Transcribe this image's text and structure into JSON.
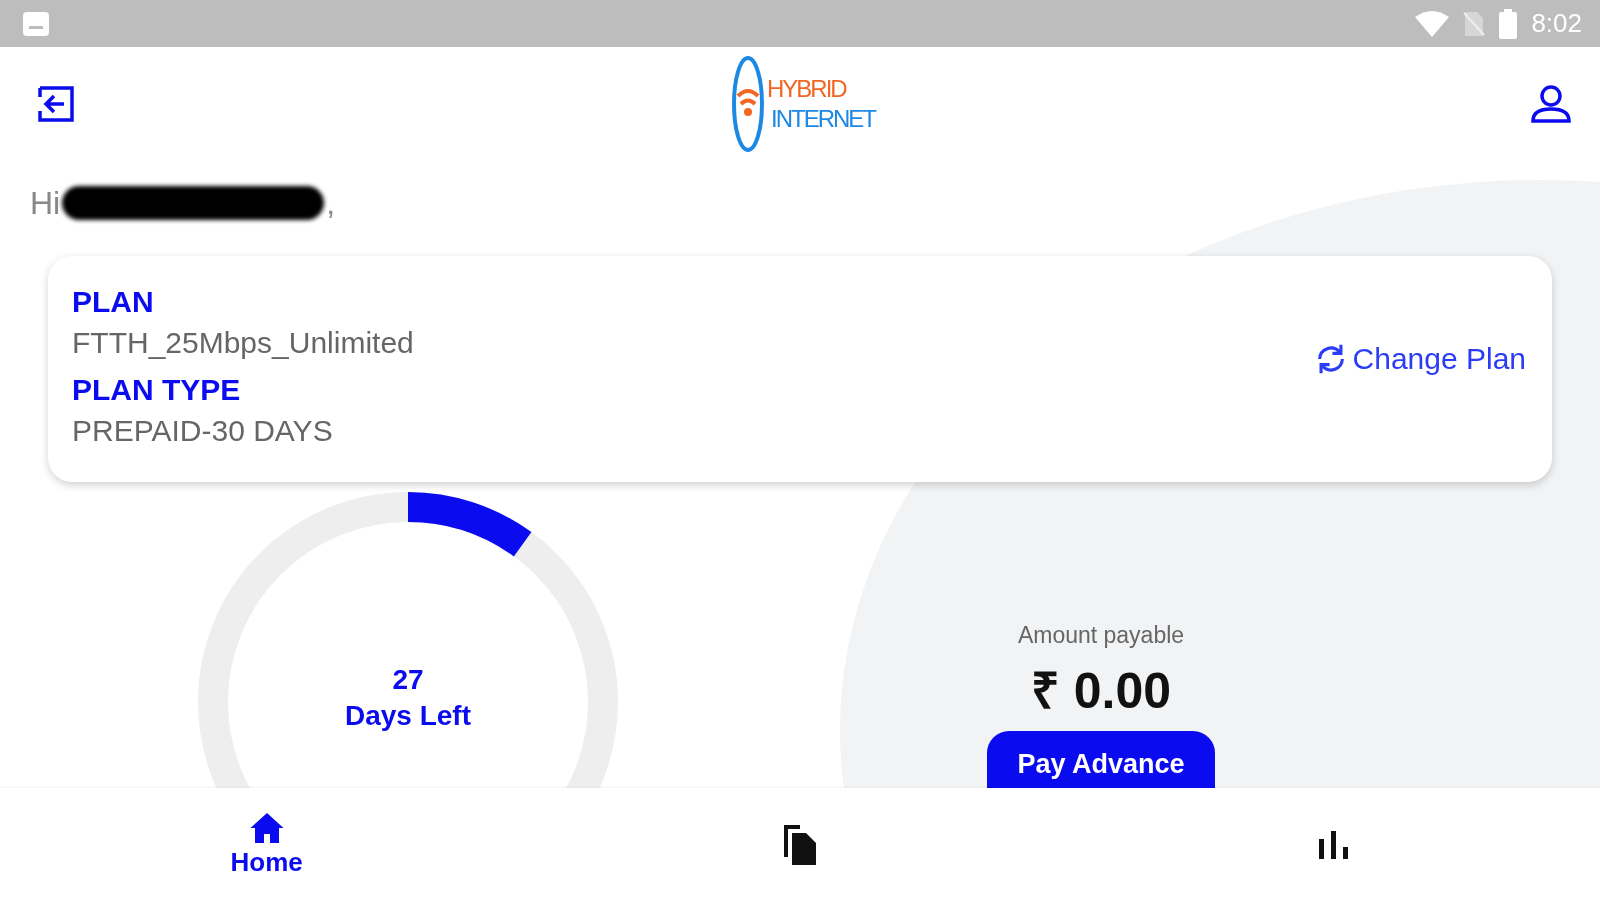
{
  "status_bar": {
    "time": "8:02"
  },
  "logo": {
    "line1": "HYBRID",
    "line2": "INTERNET"
  },
  "greeting": {
    "text": "Hi",
    "punctuation": ","
  },
  "plan_card": {
    "plan_label": "PLAN",
    "plan_value": "FTTH_25Mbps_Unlimited",
    "type_label": "PLAN TYPE",
    "type_value": "PREPAID-30 DAYS",
    "change_plan": "Change Plan"
  },
  "days_meter": {
    "level": 0.1,
    "count": "27",
    "label": "Days Left"
  },
  "payment": {
    "label": "Amount payable",
    "amount": "₹ 0.00",
    "button": "Pay Advance"
  },
  "bottom_nav": [
    {
      "label": "Home",
      "selected": true
    },
    {
      "selected": false
    },
    {
      "selected": false
    }
  ]
}
